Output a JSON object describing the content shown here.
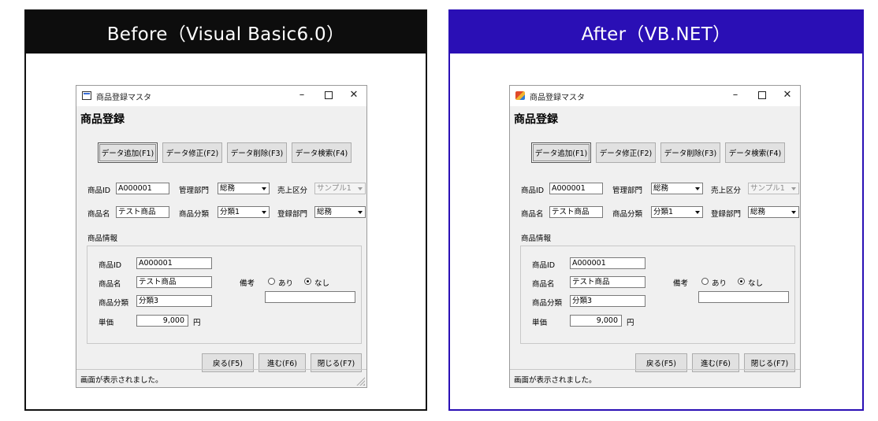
{
  "panels": [
    {
      "header": "Before（Visual Basic6.0）",
      "window": {
        "title": "商品登録マスタ",
        "icon": "vb6-form-icon",
        "heading": "商品登録",
        "buttons": [
          "データ追加(F1)",
          "データ修正(F2)",
          "データ削除(F3)",
          "データ検索(F4)"
        ],
        "fields": {
          "product_id_label": "商品ID",
          "product_id_value": "A000001",
          "dept_label": "管理部門",
          "dept_value": "総務",
          "sales_type_label": "売上区分",
          "sales_type_value": "サンプル1",
          "product_name_label": "商品名",
          "product_name_value": "テスト商品",
          "category_label": "商品分類",
          "category_value": "分類1",
          "reg_dept_label": "登録部門",
          "reg_dept_value": "総務"
        },
        "info": {
          "title": "商品情報",
          "id_label": "商品ID",
          "id_value": "A000001",
          "name_label": "商品名",
          "name_value": "テスト商品",
          "category_label": "商品分類",
          "category_value": "分類3",
          "price_label": "単価",
          "price_value": "9,000",
          "price_unit": "円",
          "remarks_label": "備考",
          "option_yes": "あり",
          "option_no": "なし",
          "remarks_value": ""
        },
        "nav_buttons": [
          "戻る(F5)",
          "進む(F6)",
          "閉じる(F7)"
        ],
        "status": "画面が表示されました。"
      }
    },
    {
      "header": "After（VB.NET）",
      "window": {
        "title": "商品登録マスタ",
        "icon": "dotnet-form-icon",
        "heading": "商品登録",
        "buttons": [
          "データ追加(F1)",
          "データ修正(F2)",
          "データ削除(F3)",
          "データ検索(F4)"
        ],
        "fields": {
          "product_id_label": "商品ID",
          "product_id_value": "A000001",
          "dept_label": "管理部門",
          "dept_value": "総務",
          "sales_type_label": "売上区分",
          "sales_type_value": "サンプル1",
          "product_name_label": "商品名",
          "product_name_value": "テスト商品",
          "category_label": "商品分類",
          "category_value": "分類1",
          "reg_dept_label": "登録部門",
          "reg_dept_value": "総務"
        },
        "info": {
          "title": "商品情報",
          "id_label": "商品ID",
          "id_value": "A000001",
          "name_label": "商品名",
          "name_value": "テスト商品",
          "category_label": "商品分類",
          "category_value": "分類3",
          "price_label": "単価",
          "price_value": "9,000",
          "price_unit": "円",
          "remarks_label": "備考",
          "option_yes": "あり",
          "option_no": "なし",
          "remarks_value": ""
        },
        "nav_buttons": [
          "戻る(F5)",
          "進む(F6)",
          "閉じる(F7)"
        ],
        "status": "画面が表示されました。"
      }
    }
  ],
  "colors": {
    "before_header": "#0d0d0d",
    "after_header": "#2a0fb5",
    "window_bg": "#f0f0f0"
  }
}
